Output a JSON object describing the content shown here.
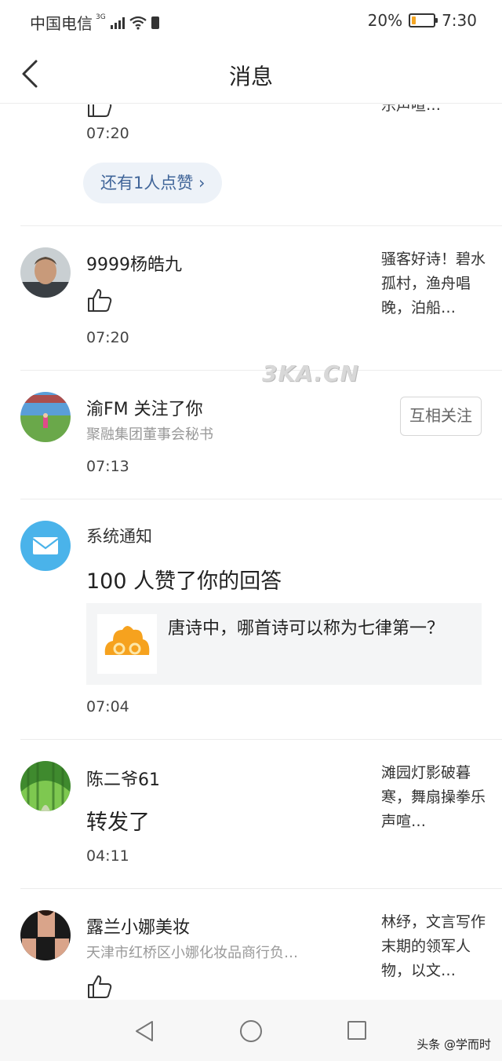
{
  "status_bar": {
    "carrier": "中国电信",
    "network": "3G",
    "battery_percent": "20%",
    "battery_level": 0.2,
    "time": "7:30"
  },
  "header": {
    "title": "消息"
  },
  "feed": {
    "partial_item": {
      "time": "07:20",
      "snippet": "乐声喧…",
      "more_likes_label": "还有1人点赞 ›"
    },
    "items": [
      {
        "type": "like",
        "name": "9999杨皓九",
        "snippet": "骚客好诗！碧水孤村，渔舟唱晚，泊船…",
        "time": "07:20"
      },
      {
        "type": "follow",
        "name": "渝FM 关注了你",
        "subtitle": "聚融集团董事会秘书",
        "button_label": "互相关注",
        "time": "07:13"
      },
      {
        "type": "system",
        "name": "系统通知",
        "message": "100 人赞了你的回答",
        "card_text": "唐诗中，哪首诗可以称为七律第一？",
        "time": "07:04"
      },
      {
        "type": "repost",
        "name": "陈二爷61",
        "message": "转发了",
        "snippet": "滩园灯影破暮寒，舞扇操拳乐声喧…",
        "time": "04:11"
      },
      {
        "type": "like",
        "name": "露兰小娜美妆",
        "subtitle": "天津市红桥区小娜化妆品商行负…",
        "snippet": "林纾，文言写作末期的领军人物，以文…"
      }
    ]
  },
  "watermark": "3KA.CN",
  "bottom_credit": "头条 @学而时",
  "colors": {
    "link_blue": "#406599",
    "mail_icon_blue": "#4ab3ea",
    "battery_orange": "#f5a623"
  }
}
